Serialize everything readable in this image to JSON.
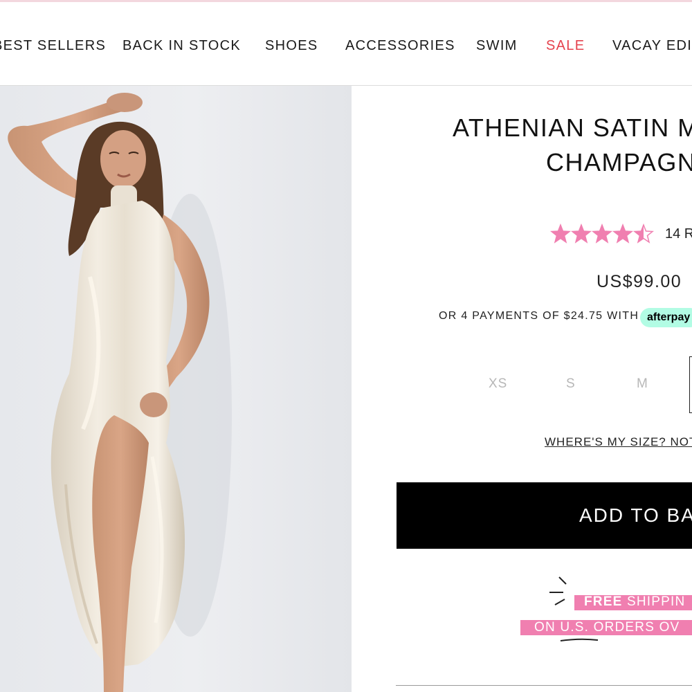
{
  "nav": {
    "items": [
      {
        "label": "BEST SELLERS"
      },
      {
        "label": "BACK IN STOCK"
      },
      {
        "label": "SHOES"
      },
      {
        "label": "ACCESSORIES"
      },
      {
        "label": "SWIM"
      },
      {
        "label": "SALE"
      },
      {
        "label": "VACAY EDIT"
      }
    ],
    "sale_color": "#e5424d"
  },
  "product": {
    "title_line1": "ATHENIAN SATIN M",
    "title_line2": "CHAMPAGN",
    "rating": 4.5,
    "rating_max": 5,
    "star_color": "#f07fb0",
    "reviews_label": "14 R",
    "price": "US$99.00",
    "installments_text": "OR 4 PAYMENTS OF $24.75 WITH",
    "afterpay_label": "afterpay",
    "afterpay_color": "#b2fce4",
    "sizes": [
      "XS",
      "S",
      "M"
    ],
    "size_help": "WHERE'S MY SIZE? NOT",
    "add_to_bag": "ADD TO BA"
  },
  "shipping": {
    "line1_bold": "FREE",
    "line1_rest": " SHIPPIN",
    "line2": "ON U.S. ORDERS OV",
    "band_color": "#f07fb0"
  }
}
